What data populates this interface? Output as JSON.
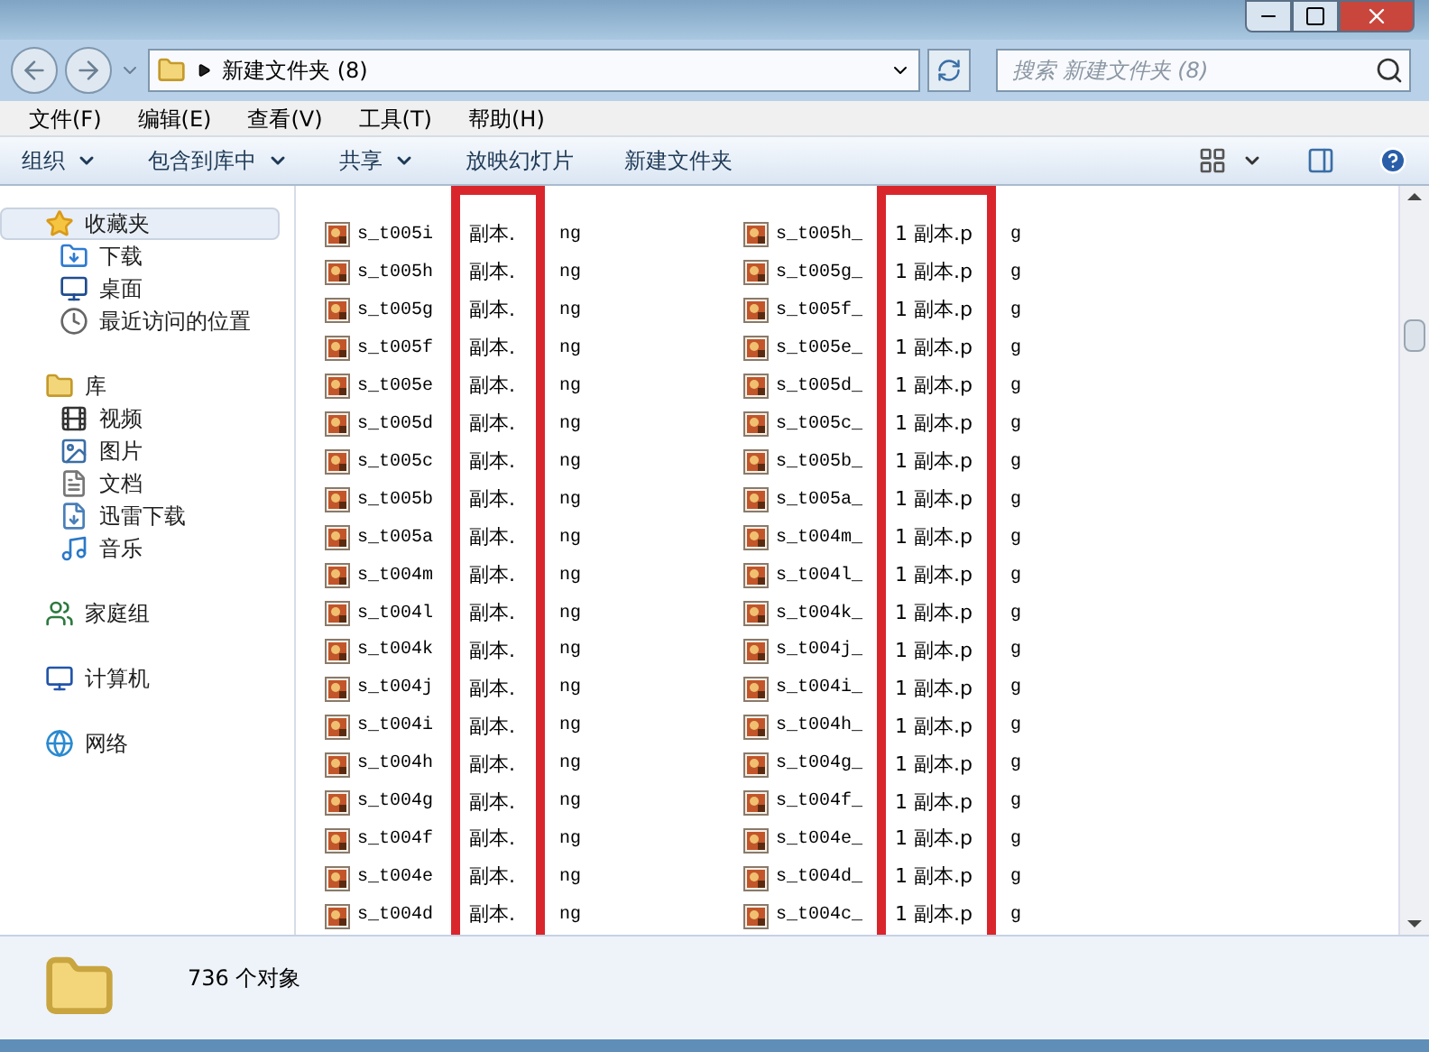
{
  "window": {
    "address": "新建文件夹 (8)",
    "search_placeholder": "搜索 新建文件夹 (8)"
  },
  "menu": [
    {
      "label": "文件(F)"
    },
    {
      "label": "编辑(E)"
    },
    {
      "label": "查看(V)"
    },
    {
      "label": "工具(T)"
    },
    {
      "label": "帮助(H)"
    }
  ],
  "toolbar": [
    {
      "label": "组织",
      "dropdown": true
    },
    {
      "label": "包含到库中",
      "dropdown": true
    },
    {
      "label": "共享",
      "dropdown": true
    },
    {
      "label": "放映幻灯片",
      "dropdown": false
    },
    {
      "label": "新建文件夹",
      "dropdown": false
    }
  ],
  "nav": [
    {
      "label": "收藏夹",
      "kind": "star",
      "selected": true,
      "children": [
        {
          "label": "下载",
          "kind": "download",
          "selected": false
        },
        {
          "label": "桌面",
          "kind": "desktop",
          "selected": false
        },
        {
          "label": "最近访问的位置",
          "kind": "recent",
          "selected": false
        }
      ]
    },
    {
      "label": "库",
      "kind": "library",
      "selected": false,
      "children": [
        {
          "label": "视频",
          "kind": "video",
          "selected": false
        },
        {
          "label": "图片",
          "kind": "picture",
          "selected": false
        },
        {
          "label": "文档",
          "kind": "document",
          "selected": false
        },
        {
          "label": "迅雷下载",
          "kind": "thunder",
          "selected": false
        },
        {
          "label": "音乐",
          "kind": "music",
          "selected": false
        }
      ]
    },
    {
      "label": "家庭组",
      "kind": "homegroup",
      "selected": false
    },
    {
      "label": "计算机",
      "kind": "computer",
      "selected": false
    },
    {
      "label": "网络",
      "kind": "network",
      "selected": false
    }
  ],
  "files": [
    {
      "highlighted": true,
      "items": [
        {
          "segments": [
            "s_t005i",
            "副本.",
            "ng"
          ]
        },
        {
          "segments": [
            "s_t005h",
            "副本.",
            "ng"
          ]
        },
        {
          "segments": [
            "s_t005g",
            "副本.",
            "ng"
          ]
        },
        {
          "segments": [
            "s_t005f",
            "副本.",
            "ng"
          ]
        },
        {
          "segments": [
            "s_t005e",
            "副本.",
            "ng"
          ]
        },
        {
          "segments": [
            "s_t005d",
            "副本.",
            "ng"
          ]
        },
        {
          "segments": [
            "s_t005c",
            "副本.",
            "ng"
          ]
        },
        {
          "segments": [
            "s_t005b",
            "副本.",
            "ng"
          ]
        },
        {
          "segments": [
            "s_t005a",
            "副本.",
            "ng"
          ]
        },
        {
          "segments": [
            "s_t004m",
            "副本.",
            "ng"
          ]
        },
        {
          "segments": [
            "s_t004l",
            "副本.",
            "ng"
          ]
        },
        {
          "segments": [
            "s_t004k",
            "副本.",
            "ng"
          ]
        },
        {
          "segments": [
            "s_t004j",
            "副本.",
            "ng"
          ]
        },
        {
          "segments": [
            "s_t004i",
            "副本.",
            "ng"
          ]
        },
        {
          "segments": [
            "s_t004h",
            "副本.",
            "ng"
          ]
        },
        {
          "segments": [
            "s_t004g",
            "副本.",
            "ng"
          ]
        },
        {
          "segments": [
            "s_t004f",
            "副本.",
            "ng"
          ]
        },
        {
          "segments": [
            "s_t004e",
            "副本.",
            "ng"
          ]
        },
        {
          "segments": [
            "s_t004d",
            "副本.",
            "ng"
          ]
        }
      ]
    },
    {
      "highlighted": true,
      "items": [
        {
          "segments": [
            "s_t005h_",
            "1 副本.p",
            "g"
          ]
        },
        {
          "segments": [
            "s_t005g_",
            "1 副本.p",
            "g"
          ]
        },
        {
          "segments": [
            "s_t005f_",
            "1 副本.p",
            "g"
          ]
        },
        {
          "segments": [
            "s_t005e_",
            "1 副本.p",
            "g"
          ]
        },
        {
          "segments": [
            "s_t005d_",
            "1 副本.p",
            "g"
          ]
        },
        {
          "segments": [
            "s_t005c_",
            "1 副本.p",
            "g"
          ]
        },
        {
          "segments": [
            "s_t005b_",
            "1 副本.p",
            "g"
          ]
        },
        {
          "segments": [
            "s_t005a_",
            "1 副本.p",
            "g"
          ]
        },
        {
          "segments": [
            "s_t004m_",
            "1 副本.p",
            "g"
          ]
        },
        {
          "segments": [
            "s_t004l_",
            "1 副本.p",
            "g"
          ]
        },
        {
          "segments": [
            "s_t004k_",
            "1 副本.p",
            "g"
          ]
        },
        {
          "segments": [
            "s_t004j_",
            "1 副本.p",
            "g"
          ]
        },
        {
          "segments": [
            "s_t004i_",
            "1 副本.p",
            "g"
          ]
        },
        {
          "segments": [
            "s_t004h_",
            "1 副本.p",
            "g"
          ]
        },
        {
          "segments": [
            "s_t004g_",
            "1 副本.p",
            "g"
          ]
        },
        {
          "segments": [
            "s_t004f_",
            "1 副本.p",
            "g"
          ]
        },
        {
          "segments": [
            "s_t004e_",
            "1 副本.p",
            "g"
          ]
        },
        {
          "segments": [
            "s_t004d_",
            "1 副本.p",
            "g"
          ]
        },
        {
          "segments": [
            "s_t004c_",
            "1 副本.p",
            "g"
          ]
        }
      ]
    }
  ],
  "status": {
    "count": "736 个对象"
  }
}
